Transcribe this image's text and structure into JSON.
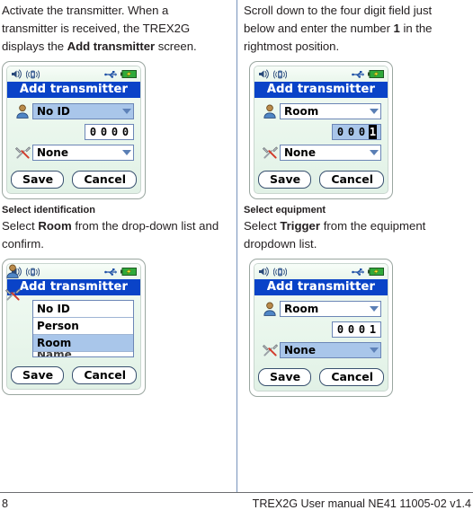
{
  "document": {
    "footer": {
      "page_number": "8",
      "manual_reference": "TREX2G User manual NE41 11005-02 v1.4"
    }
  },
  "left_column": {
    "intro_paragraph": {
      "part1": "Activate the transmitter. When a transmitter is received, the TREX2G displays the ",
      "bold": "Add transmitter",
      "part2": " screen."
    },
    "figure1": {
      "statusbar": {
        "sound_icon": "speaker-icon",
        "vibrate_icon": "vibrate-icon",
        "usb_icon": "usb-icon",
        "battery_icon": "battery-charging-icon"
      },
      "title": "Add transmitter",
      "identification_field": {
        "value": "No ID",
        "selected": true
      },
      "digits": {
        "values": [
          "0",
          "0",
          "0",
          "0"
        ],
        "selected": false,
        "inverted_index": -1
      },
      "equipment_field": {
        "value": "None",
        "selected": false
      },
      "save_button": "Save",
      "cancel_button": "Cancel"
    },
    "caption": {
      "heading": "Select identification",
      "part1": "Select ",
      "bold": "Room",
      "part2": " from the drop-down list and confirm."
    },
    "figure2": {
      "statusbar": {
        "sound_icon": "speaker-icon",
        "vibrate_icon": "vibrate-icon",
        "usb_icon": "usb-icon",
        "battery_icon": "battery-charging-icon"
      },
      "title": "Add transmitter",
      "dropdown_options": [
        {
          "label": "No ID",
          "selected": false
        },
        {
          "label": "Person",
          "selected": false
        },
        {
          "label": "Room",
          "selected": true
        },
        {
          "label": "Name",
          "selected": false,
          "clipped": true
        }
      ],
      "save_button": "Save",
      "cancel_button": "Cancel"
    }
  },
  "right_column": {
    "intro_paragraph": {
      "part1": "Scroll down to the four digit field just below and enter the number ",
      "bold": "1",
      "part2": " in the rightmost position."
    },
    "figure3": {
      "statusbar": {
        "sound_icon": "speaker-icon",
        "vibrate_icon": "vibrate-icon",
        "usb_icon": "usb-icon",
        "battery_icon": "battery-charging-icon"
      },
      "title": "Add transmitter",
      "identification_field": {
        "value": "Room",
        "selected": false
      },
      "digits": {
        "values": [
          "0",
          "0",
          "0",
          "1"
        ],
        "selected": true,
        "inverted_index": 3
      },
      "equipment_field": {
        "value": "None",
        "selected": false
      },
      "save_button": "Save",
      "cancel_button": "Cancel"
    },
    "caption": {
      "heading": "Select equipment",
      "part1": "Select ",
      "bold": "Trigger",
      "part2": " from the equipment dropdown list."
    },
    "figure4": {
      "statusbar": {
        "sound_icon": "speaker-icon",
        "vibrate_icon": "vibrate-icon",
        "usb_icon": "usb-icon",
        "battery_icon": "battery-charging-icon"
      },
      "title": "Add transmitter",
      "identification_field": {
        "value": "Room",
        "selected": false
      },
      "digits": {
        "values": [
          "0",
          "0",
          "0",
          "1"
        ],
        "selected": false,
        "inverted_index": -1
      },
      "equipment_field": {
        "value": "None",
        "selected": true
      },
      "save_button": "Save",
      "cancel_button": "Cancel"
    }
  },
  "colors": {
    "titlebar_blue": "#0a43c8",
    "selection_blue": "#a9c6ea",
    "field_border": "#6c86b6",
    "screen_green": "#e9f6ec",
    "battery_green": "#2faa3a",
    "divider_blue": "#4a6fa5"
  }
}
